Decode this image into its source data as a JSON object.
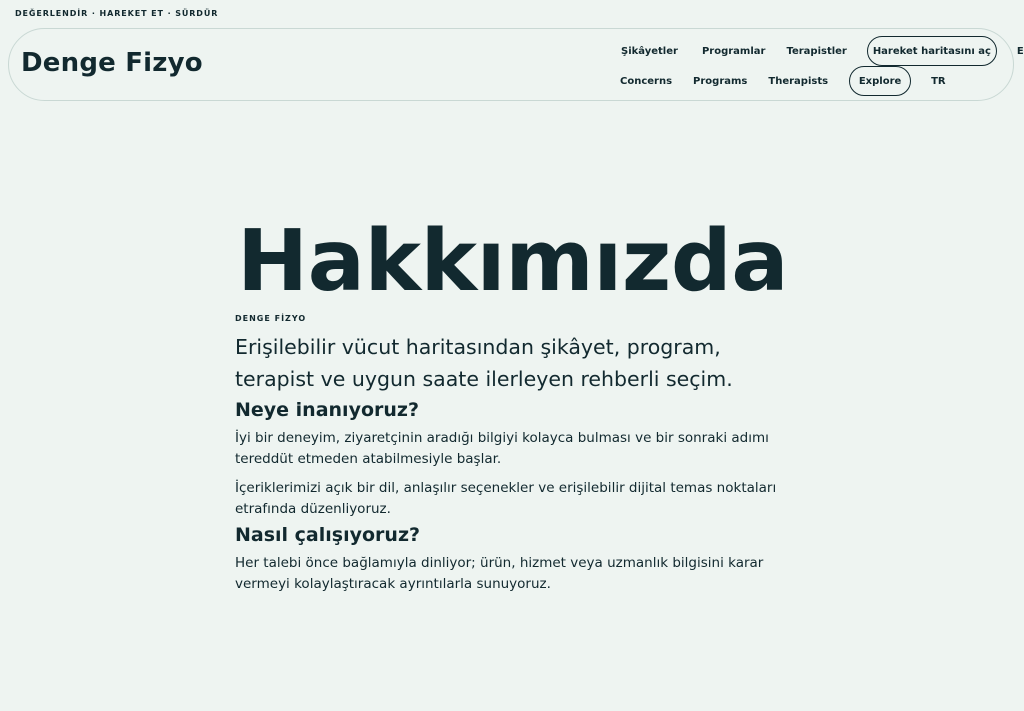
{
  "topline": "DEĞERLENDİR · HAREKET ET · SÜRDÜR",
  "header": {
    "brand": "Denge Fizyo",
    "nav_tr": {
      "links": [
        "Şikâyetler",
        "Programlar",
        "Terapistler"
      ],
      "cta": "Hareket haritasını aç",
      "lang": "EN"
    },
    "nav_en": {
      "links": [
        "Concerns",
        "Programs",
        "Therapists"
      ],
      "cta": "Explore",
      "lang": "TR"
    }
  },
  "main": {
    "title": "Hakkımızda",
    "eyebrow": "DENGE FİZYO",
    "lead": "Erişilebilir vücut haritasından şikâyet, program, terapist ve uygun saate ilerleyen rehberli seçim.",
    "sections": [
      {
        "heading": "Neye inanıyoruz?",
        "paragraphs": [
          "İyi bir deneyim, ziyaretçinin aradığı bilgiyi kolayca bulması ve bir sonraki adımı tereddüt etmeden atabilmesiyle başlar.",
          "İçeriklerimizi açık bir dil, anlaşılır seçenekler ve erişilebilir dijital temas noktaları etrafında düzenliyoruz."
        ]
      },
      {
        "heading": "Nasıl çalışıyoruz?",
        "paragraphs": [
          "Her talebi önce bağlamıyla dinliyor; ürün, hizmet veya uzmanlık bilgisini karar vermeyi kolaylaştıracak ayrıntılarla sunuyoruz."
        ]
      }
    ]
  },
  "colors": {
    "background": "#eef4f1",
    "text": "#12292f",
    "border": "#c9d8d4"
  }
}
